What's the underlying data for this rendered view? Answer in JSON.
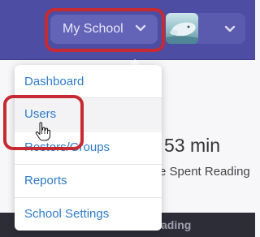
{
  "header": {
    "school_selector_label": "My School",
    "school_selector_icon": "chevron-down-icon",
    "profile_menu_icon": "chevron-down-icon",
    "accent": "#4d4da3",
    "highlight_color": "#c62a32"
  },
  "dropdown": {
    "items": [
      {
        "label": "Dashboard"
      },
      {
        "label": "Users"
      },
      {
        "label": "Rosters/Groups"
      },
      {
        "label": "Reports"
      },
      {
        "label": "School Settings"
      }
    ],
    "link_color": "#2f7bc9"
  },
  "background": {
    "time_value": "53 min",
    "time_label": "e Spent Reading",
    "strip_text": "ading"
  }
}
